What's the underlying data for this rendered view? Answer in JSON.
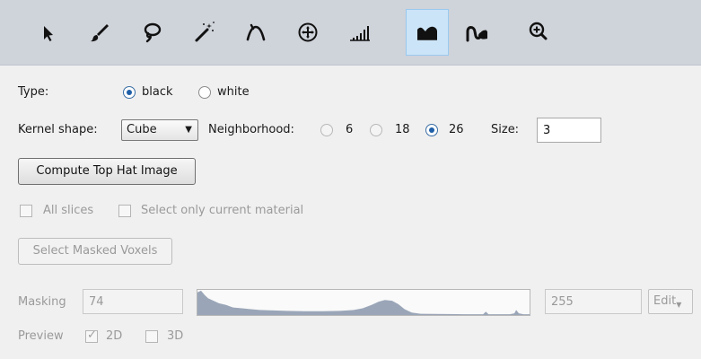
{
  "toolbar": {
    "tools": [
      {
        "icon": "arrow-pointer-icon"
      },
      {
        "icon": "brush-icon"
      },
      {
        "icon": "lasso-icon"
      },
      {
        "icon": "magic-wand-icon"
      },
      {
        "icon": "propagation-icon"
      },
      {
        "icon": "blow-tool-icon"
      },
      {
        "icon": "threshold-icon"
      },
      {
        "icon": "top-hat-icon"
      },
      {
        "icon": "watershed-icon"
      },
      {
        "icon": "zoom-icon"
      }
    ],
    "active_index": 7
  },
  "type": {
    "label": "Type:",
    "options": [
      {
        "label": "black",
        "checked": true
      },
      {
        "label": "white",
        "checked": false
      }
    ]
  },
  "kernel": {
    "label": "Kernel shape:",
    "value": "Cube"
  },
  "neighborhood": {
    "label": "Neighborhood:",
    "options": [
      {
        "label": "6",
        "checked": false
      },
      {
        "label": "18",
        "checked": false
      },
      {
        "label": "26",
        "checked": true
      }
    ]
  },
  "size": {
    "label": "Size:",
    "value": "3"
  },
  "compute_button": "Compute Top Hat Image",
  "all_slices": {
    "label": "All slices",
    "checked": false
  },
  "select_only_current": {
    "label": "Select only current material",
    "checked": false
  },
  "select_masked_button": "Select Masked Voxels",
  "masking": {
    "label": "Masking",
    "min_value": "74",
    "max_value": "255",
    "edit_label": "Edit"
  },
  "preview": {
    "label": "Preview",
    "options": [
      {
        "label": "2D",
        "checked": true
      },
      {
        "label": "3D",
        "checked": false
      }
    ]
  },
  "colors": {
    "toolbar_bg": "#cfd3da",
    "active_tool_bg": "#cce4f7",
    "radio_accent": "#1f5fa8",
    "histogram_fill": "#9aa6b8"
  }
}
